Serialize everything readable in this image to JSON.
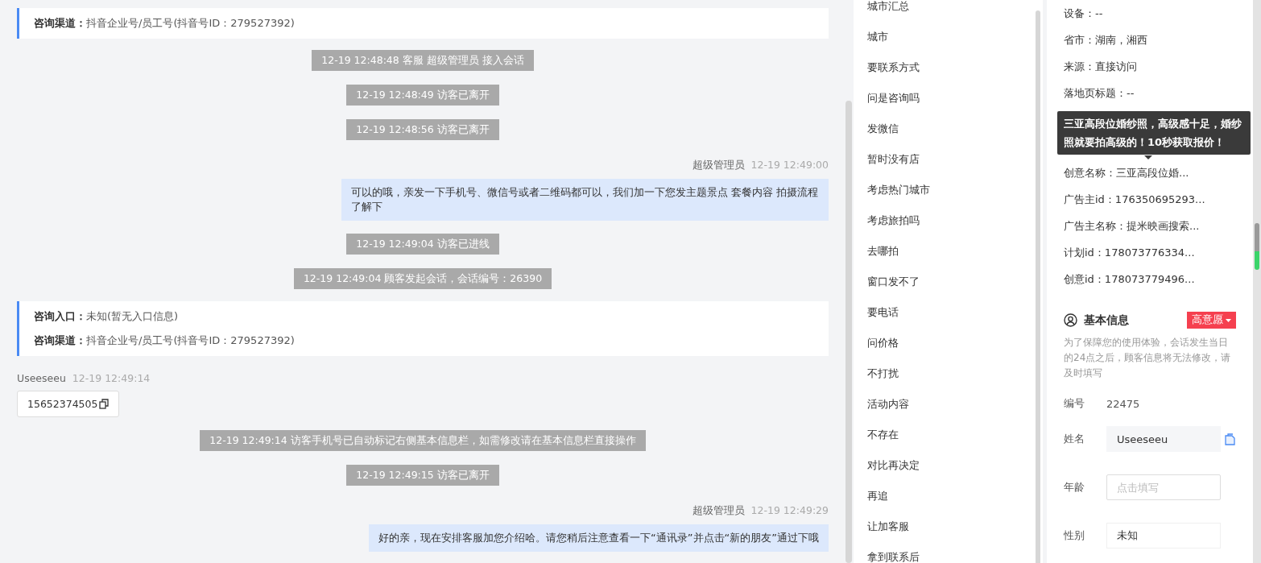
{
  "chat": {
    "messages": [
      {
        "kind": "info",
        "lines": [
          {
            "label": "咨询渠道：",
            "value": "抖音企业号/员工号(抖音号ID：279527392)"
          }
        ]
      },
      {
        "kind": "system",
        "text": "12-19 12:48:48 客服 超级管理员 接入会话"
      },
      {
        "kind": "system",
        "text": "12-19 12:48:49 访客已离开"
      },
      {
        "kind": "system",
        "text": "12-19 12:48:56 访客已离开"
      },
      {
        "kind": "agent",
        "sender": "超级管理员",
        "time": "12-19 12:49:00",
        "text": "可以的哦，亲发一下手机号、微信号或者二维码都可以，我们加一下您发主题景点 套餐内容 拍摄流程了解下"
      },
      {
        "kind": "system",
        "text": "12-19 12:49:04 访客已进线"
      },
      {
        "kind": "system",
        "text": "12-19 12:49:04 顾客发起会话，会话编号：26390"
      },
      {
        "kind": "info",
        "lines": [
          {
            "label": "咨询入口：",
            "value": "未知(暂无入口信息)"
          },
          {
            "label": "咨询渠道：",
            "value": "抖音企业号/员工号(抖音号ID：279527392)"
          }
        ]
      },
      {
        "kind": "visitor",
        "sender": "Useeseeu",
        "time": "12-19 12:49:14",
        "text": "15652374505"
      },
      {
        "kind": "system",
        "text": "12-19 12:49:14 访客手机号已自动标记右侧基本信息栏，如需修改请在基本信息栏直接操作"
      },
      {
        "kind": "system",
        "text": "12-19 12:49:15 访客已离开"
      },
      {
        "kind": "agent",
        "sender": "超级管理员",
        "time": "12-19 12:49:29",
        "text": "好的亲，现在安排客服加您介绍哈。请您稍后注意查看一下“通讯录”并点击“新的朋友”通过下哦"
      }
    ]
  },
  "tags": [
    "城市汇总",
    "城市",
    "要联系方式",
    "问是咨询吗",
    "发微信",
    "暂时没有店",
    "考虑热门城市",
    "考虑旅拍吗",
    "去哪拍",
    "窗口发不了",
    "要电话",
    "问价格",
    "不打扰",
    "活动内容",
    "不存在",
    "对比再决定",
    "再追",
    "让加客服",
    "拿到联系后"
  ],
  "visit_details": {
    "before": [
      "设备：--",
      "省市：湖南，湘西",
      "来源：直接访问",
      "落地页标题：--"
    ],
    "tooltip": "三亚高段位婚纱照，高级感十足，婚纱照就要拍高级的！10秒获取报价！",
    "after": [
      "创意名称：三亚高段位婚...",
      "广告主id：176350695293...",
      "广告主名称：提米映画搜索...",
      "计划id：178073776334...",
      "创意id：178073779496..."
    ]
  },
  "basic_info": {
    "title": "基本信息",
    "intent": "高意愿",
    "notice": "为了保障您的使用体验，会话发生当日的24点之后，顾客信息将无法修改，请及时填写",
    "fields": [
      {
        "kind": "text",
        "label": "编号",
        "value": "22475"
      },
      {
        "kind": "readonly",
        "label": "姓名",
        "value": "Useeseeu"
      },
      {
        "kind": "input",
        "label": "年龄",
        "placeholder": "点击填写"
      },
      {
        "kind": "select",
        "label": "性别",
        "value": "未知"
      }
    ]
  }
}
